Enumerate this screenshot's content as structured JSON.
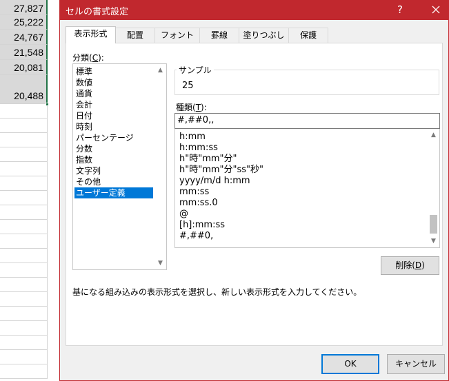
{
  "spreadsheet": {
    "cells": [
      "27,827",
      "25,222",
      "24,767",
      "21,548",
      "20,081",
      "20,488"
    ]
  },
  "dialog": {
    "title": "セルの書式設定",
    "help_label": "?",
    "tabs": [
      "表示形式",
      "配置",
      "フォント",
      "罫線",
      "塗りつぶし",
      "保護"
    ],
    "active_tab": "表示形式",
    "category": {
      "label_prefix": "分類(",
      "label_key": "C",
      "label_suffix": "):",
      "items": [
        "標準",
        "数値",
        "通貨",
        "会計",
        "日付",
        "時刻",
        "パーセンテージ",
        "分数",
        "指数",
        "文字列",
        "その他",
        "ユーザー定義"
      ],
      "selected": "ユーザー定義"
    },
    "sample": {
      "label": "サンプル",
      "value": "25"
    },
    "type": {
      "label_prefix": "種類(",
      "label_key": "T",
      "label_suffix": "):",
      "input_value": "#,##0,,",
      "formats": [
        "h:mm",
        "h:mm:ss",
        "h\"時\"mm\"分\"",
        "h\"時\"mm\"分\"ss\"秒\"",
        "yyyy/m/d h:mm",
        "mm:ss",
        "mm:ss.0",
        "@",
        "[h]:mm:ss",
        "#,##0,"
      ]
    },
    "delete_button": {
      "label_prefix": "削除(",
      "label_key": "D",
      "label_suffix": ")"
    },
    "description": "基になる組み込みの表示形式を選択し、新しい表示形式を入力してください。",
    "ok_label": "OK",
    "cancel_label": "キャンセル"
  },
  "colors": {
    "titlebar": "#c1282e",
    "selection": "#0078d7",
    "sheet_selection_border": "#217346"
  }
}
